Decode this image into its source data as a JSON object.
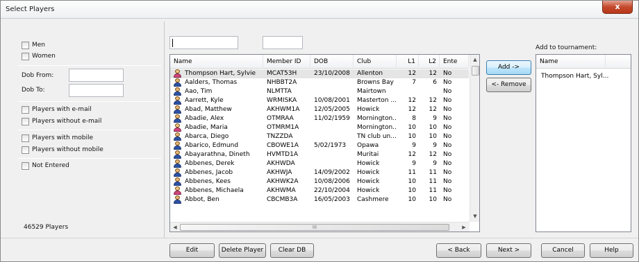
{
  "window": {
    "title": "Select Players",
    "close_glyph": "x"
  },
  "filters": {
    "men": "Men",
    "women": "Women",
    "dob_from": "Dob From:",
    "dob_to": "Dob To:",
    "with_email": "Players with e-mail",
    "without_email": "Players without e-mail",
    "with_mobile": "Players with mobile",
    "without_mobile": "Players without mobile",
    "not_entered": "Not Entered",
    "player_count": "46529 Players"
  },
  "grid": {
    "columns": [
      "Name",
      "Member ID",
      "DOB",
      "Club",
      "L1",
      "L2",
      "Ente"
    ],
    "rows": [
      {
        "gender": "f",
        "name": "Thompson Hart, Sylvie",
        "id": "MCAT53H",
        "dob": "23/10/2008",
        "club": "Allenton",
        "l1": "12",
        "l2": "12",
        "ent": "No"
      },
      {
        "gender": "m",
        "name": "Aalders, Thomas",
        "id": "NHBBT2A",
        "dob": "",
        "club": "Browns Bay",
        "l1": "7",
        "l2": "6",
        "ent": "No"
      },
      {
        "gender": "m",
        "name": "Aao, Tim",
        "id": "NLMTTA",
        "dob": "",
        "club": "Mairtown",
        "l1": "",
        "l2": "",
        "ent": "No"
      },
      {
        "gender": "m",
        "name": "Aarrett, Kyle",
        "id": "WRMISKA",
        "dob": "10/08/2001",
        "club": "Masterton ...",
        "l1": "12",
        "l2": "12",
        "ent": "No"
      },
      {
        "gender": "m",
        "name": "Abad, Matthew",
        "id": "AKHWM1A",
        "dob": "12/05/2005",
        "club": "Howick",
        "l1": "12",
        "l2": "12",
        "ent": "No"
      },
      {
        "gender": "m",
        "name": "Abadie, Alex",
        "id": "OTMRAA",
        "dob": "11/02/1959",
        "club": "Mornington...",
        "l1": "8",
        "l2": "9",
        "ent": "No"
      },
      {
        "gender": "f",
        "name": "Abadie, Maria",
        "id": "OTMRM1A",
        "dob": "",
        "club": "Mornington...",
        "l1": "10",
        "l2": "10",
        "ent": "No"
      },
      {
        "gender": "m",
        "name": "Abarca, Diego",
        "id": "TNZZDA",
        "dob": "",
        "club": "TN club un...",
        "l1": "10",
        "l2": "10",
        "ent": "No"
      },
      {
        "gender": "m",
        "name": "Abarico, Edmund",
        "id": "CBOWE1A",
        "dob": "5/02/1973",
        "club": "Opawa",
        "l1": "9",
        "l2": "9",
        "ent": "No"
      },
      {
        "gender": "m",
        "name": "Abayarathna, Dineth",
        "id": "HVMTD1A",
        "dob": "",
        "club": "Muritai",
        "l1": "12",
        "l2": "12",
        "ent": "No"
      },
      {
        "gender": "m",
        "name": "Abbenes, Derek",
        "id": "AKHWDA",
        "dob": "",
        "club": "Howick",
        "l1": "9",
        "l2": "9",
        "ent": "No"
      },
      {
        "gender": "m",
        "name": "Abbenes, Jacob",
        "id": "AKHWJA",
        "dob": "14/09/2002",
        "club": "Howick",
        "l1": "11",
        "l2": "11",
        "ent": "No"
      },
      {
        "gender": "m",
        "name": "Abbenes, Kees",
        "id": "AKHWK2A",
        "dob": "10/08/2006",
        "club": "Howick",
        "l1": "10",
        "l2": "11",
        "ent": "No"
      },
      {
        "gender": "f",
        "name": "Abbenes, Michaela",
        "id": "AKHWMA",
        "dob": "22/10/2004",
        "club": "Howick",
        "l1": "10",
        "l2": "11",
        "ent": "No"
      },
      {
        "gender": "m",
        "name": "Abbot, Ben",
        "id": "CBCMB3A",
        "dob": "16/05/2003",
        "club": "Cashmere",
        "l1": "10",
        "l2": "10",
        "ent": "No"
      }
    ],
    "hscroll_marker": "III"
  },
  "actions": {
    "add": "Add ->",
    "remove": "<- Remove"
  },
  "tournament": {
    "heading": "Add to tournament:",
    "column": "Name",
    "items": [
      "Thompson Hart, Syl..."
    ]
  },
  "footer": {
    "edit": "Edit",
    "delete": "Delete Player",
    "clear": "Clear DB",
    "back": "< Back",
    "next": "Next >",
    "cancel": "Cancel",
    "help": "Help"
  }
}
